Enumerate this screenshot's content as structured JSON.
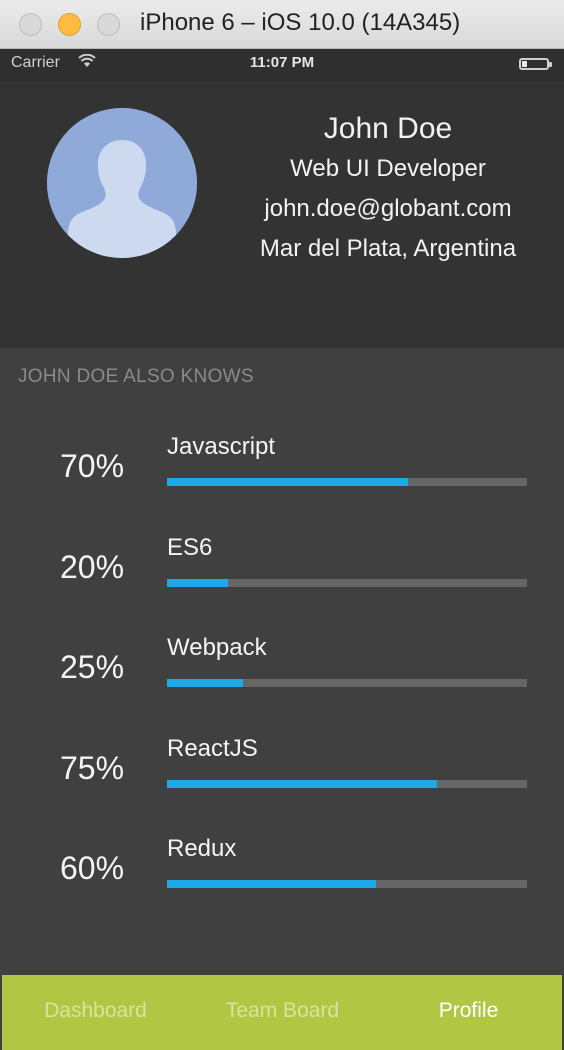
{
  "window": {
    "title": "iPhone 6 – iOS 10.0 (14A345)"
  },
  "status_bar": {
    "carrier": "Carrier",
    "time": "11:07 PM",
    "battery_level": 0.2
  },
  "profile": {
    "name": "John Doe",
    "role": "Web UI Developer",
    "email": "john.doe@globant.com",
    "location": "Mar del Plata, Argentina",
    "avatar_icon": "person-placeholder-icon"
  },
  "skills_section": {
    "title": "JOHN DOE ALSO KNOWS",
    "skills": [
      {
        "name": "Javascript",
        "percent_label": "70%",
        "percent": 67
      },
      {
        "name": "ES6",
        "percent_label": "20%",
        "percent": 17
      },
      {
        "name": "Webpack",
        "percent_label": "25%",
        "percent": 21
      },
      {
        "name": "ReactJS",
        "percent_label": "75%",
        "percent": 75
      },
      {
        "name": "Redux",
        "percent_label": "60%",
        "percent": 58
      }
    ]
  },
  "tabs": [
    {
      "label": "Dashboard",
      "active": false
    },
    {
      "label": "Team Board",
      "active": false
    },
    {
      "label": "Profile",
      "active": true
    }
  ],
  "colors": {
    "accent": "#1fa8e8",
    "tabbar": "#b1c744",
    "background": "#404040",
    "header": "#333333"
  }
}
